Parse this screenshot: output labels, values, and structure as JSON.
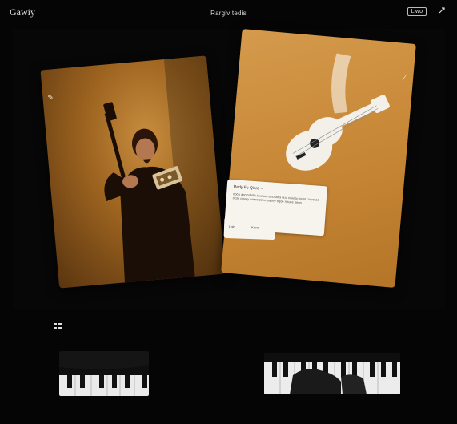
{
  "app": {
    "brand": "Gawiy",
    "title": "Rargiv tedis",
    "top_button": "Liwo"
  },
  "popup": {
    "title": "Redy Fu Qisre  ~",
    "text": "ooou aqoiod riliy tounuo rortosoos ouu cowiou oyoo ruvve oe ocoe pouey eoere oene oaeey oqoe nouee oeoo",
    "btn_left": "Loio",
    "btn_right": "Kavo"
  },
  "icons": {
    "top_right": "share-icon",
    "card_corner_left": "pencil-icon",
    "card_corner_right": "pin-icon",
    "small_icon": "grid-icon"
  },
  "colors": {
    "background": "#050505",
    "accent": "#c88d3e"
  }
}
